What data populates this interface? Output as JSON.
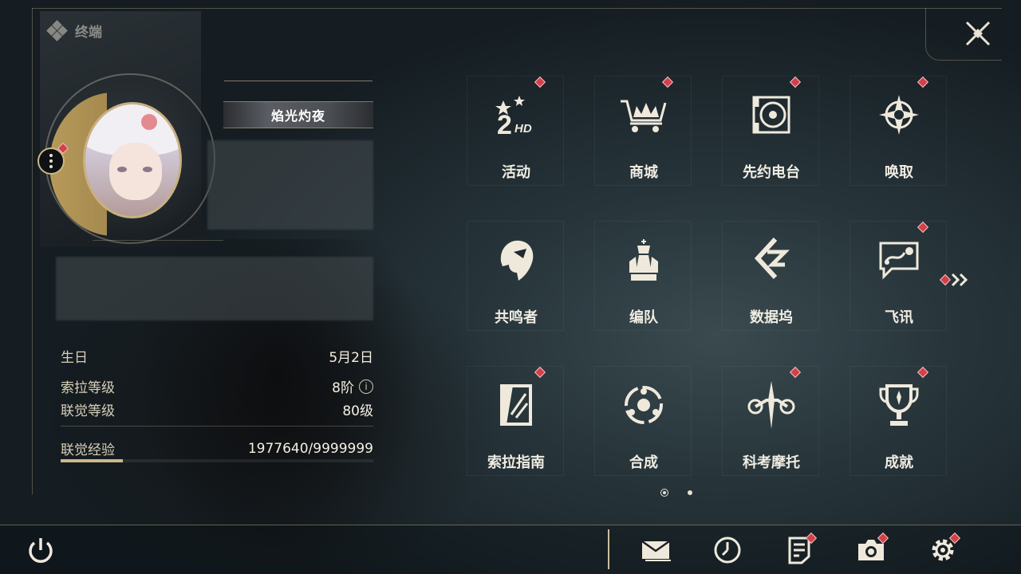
{
  "header": {
    "title": "终端"
  },
  "profile": {
    "name_tag": "焰光灼夜"
  },
  "stats": {
    "birthday_label": "生日",
    "birthday_value": "5月2日",
    "sola_level_label": "索拉等级",
    "sola_level_value": "8阶",
    "union_level_label": "联觉等级",
    "union_level_value": "80级",
    "union_exp_label": "联觉经验",
    "union_exp_value": "1977640/9999999",
    "union_exp_progress": 0.1978,
    "info_glyph": "i"
  },
  "menu": {
    "items": [
      {
        "label": "活动",
        "icon": "event-2hd-icon",
        "badge": true
      },
      {
        "label": "商城",
        "icon": "shop-cart-icon",
        "badge": true
      },
      {
        "label": "先约电台",
        "icon": "radio-disc-icon",
        "badge": true
      },
      {
        "label": "唤取",
        "icon": "convene-star-icon",
        "badge": true
      },
      {
        "label": "共鸣者",
        "icon": "resonator-head-icon",
        "badge": false
      },
      {
        "label": "编队",
        "icon": "team-chess-icon",
        "badge": false
      },
      {
        "label": "数据坞",
        "icon": "data-bank-icon",
        "badge": false
      },
      {
        "label": "飞讯",
        "icon": "message-chat-icon",
        "badge": true
      },
      {
        "label": "索拉指南",
        "icon": "guide-book-icon",
        "badge": true
      },
      {
        "label": "合成",
        "icon": "synthesis-icon",
        "badge": false
      },
      {
        "label": "科考摩托",
        "icon": "motorcycle-icon",
        "badge": true
      },
      {
        "label": "成就",
        "icon": "trophy-icon",
        "badge": true
      }
    ]
  },
  "pager": {
    "current": 1,
    "total": 2
  },
  "bottom_bar": {
    "buttons": [
      {
        "name": "mail-icon",
        "badge": false
      },
      {
        "name": "clock-icon",
        "badge": false
      },
      {
        "name": "notice-icon",
        "badge": true
      },
      {
        "name": "camera-icon",
        "badge": true
      },
      {
        "name": "settings-gear-icon",
        "badge": true
      }
    ]
  },
  "colors": {
    "accent_gold": "#cdb88a",
    "badge_red": "#d3404a",
    "text": "#e8e2d2"
  }
}
